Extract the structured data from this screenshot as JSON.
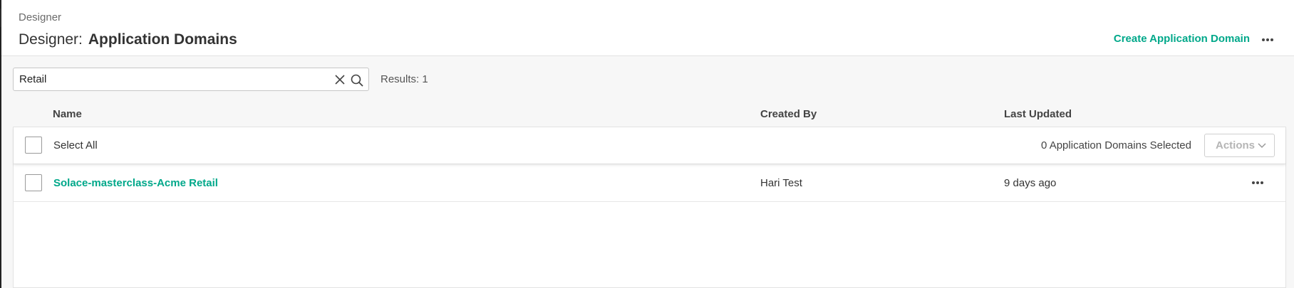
{
  "header": {
    "breadcrumb": "Designer",
    "title_prefix": "Designer:",
    "title": "Application Domains",
    "create_label": "Create Application Domain"
  },
  "search": {
    "value": "Retail",
    "placeholder": "",
    "results_label": "Results: 1"
  },
  "table": {
    "columns": [
      "Name",
      "Created By",
      "Last Updated"
    ],
    "select_all_label": "Select All",
    "selected_count": "0 Application Domains Selected",
    "actions_label": "Actions",
    "rows": [
      {
        "name": "Solace-masterclass-Acme Retail",
        "created_by": "Hari Test",
        "last_updated": "9 days ago"
      }
    ]
  },
  "icons": {
    "collapse": "chevron-right-icon",
    "more": "more-horizontal-icon",
    "clear": "close-icon",
    "search": "search-icon",
    "dropdown": "chevron-down-icon"
  },
  "colors": {
    "accent": "#00a88a",
    "background": "#f7f7f7",
    "surface": "#ffffff"
  }
}
